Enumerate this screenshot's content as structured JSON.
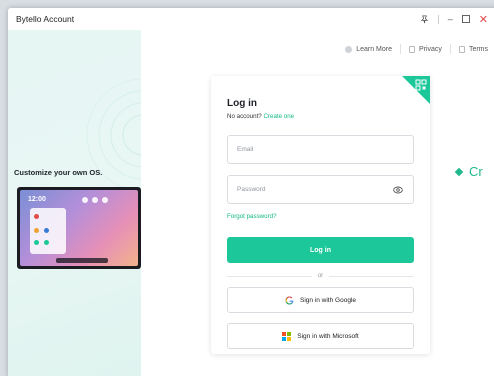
{
  "window": {
    "title": "Bytello Account"
  },
  "top_links": {
    "learn_more": "Learn More",
    "privacy": "Privacy",
    "terms": "Terms"
  },
  "left_panel": {
    "tagline": "Customize your own OS.",
    "device_clock": "12:00"
  },
  "login": {
    "title": "Log in",
    "no_account": "No account?",
    "create_one": "Create one",
    "email_placeholder": "Email",
    "password_placeholder": "Password",
    "forgot": "Forgot password?",
    "button": "Log in",
    "or": "or",
    "google": "Sign in with Google",
    "microsoft": "Sign in with Microsoft"
  },
  "side_text": "Cr",
  "colors": {
    "accent": "#1cc89a",
    "close": "#e24a4a"
  },
  "icons": [
    "pin-icon",
    "minimize-icon",
    "maximize-icon",
    "close-icon",
    "qr-code-icon",
    "eye-icon",
    "google-logo-icon",
    "microsoft-logo-icon"
  ]
}
